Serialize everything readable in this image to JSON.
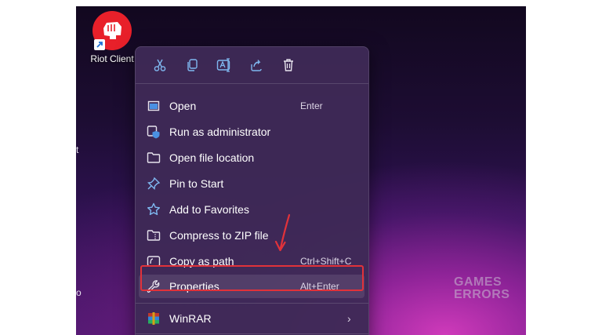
{
  "desktop": {
    "icon_label": "Riot Client",
    "edge_fragment_1": "t",
    "edge_fragment_2": "o"
  },
  "toolbar": {
    "items": [
      {
        "icon": "scissors-icon",
        "name": "cut"
      },
      {
        "icon": "copy-icon",
        "name": "copy"
      },
      {
        "icon": "rename-icon",
        "name": "rename"
      },
      {
        "icon": "share-icon",
        "name": "share"
      },
      {
        "icon": "trash-icon",
        "name": "delete"
      }
    ]
  },
  "menu": {
    "items": [
      {
        "label": "Open",
        "shortcut": "Enter",
        "icon": "open-window-icon"
      },
      {
        "label": "Run as administrator",
        "shortcut": "",
        "icon": "shield-admin-icon"
      },
      {
        "label": "Open file location",
        "shortcut": "",
        "icon": "folder-icon"
      },
      {
        "label": "Pin to Start",
        "shortcut": "",
        "icon": "pin-icon"
      },
      {
        "label": "Add to Favorites",
        "shortcut": "",
        "icon": "star-icon"
      },
      {
        "label": "Compress to ZIP file",
        "shortcut": "",
        "icon": "zip-folder-icon"
      },
      {
        "label": "Copy as path",
        "shortcut": "Ctrl+Shift+C",
        "icon": "copy-path-icon"
      },
      {
        "label": "Properties",
        "shortcut": "Alt+Enter",
        "icon": "wrench-icon"
      },
      {
        "label": "WinRAR",
        "shortcut": "",
        "icon": "winrar-icon"
      }
    ]
  },
  "watermark": {
    "line1": "GAMES",
    "line2": "ERRORS"
  },
  "colors": {
    "highlight_border": "#e1323a",
    "arrow": "#e1323a",
    "riot_red": "#e8202a",
    "icon_blue": "#7fb8f0"
  }
}
